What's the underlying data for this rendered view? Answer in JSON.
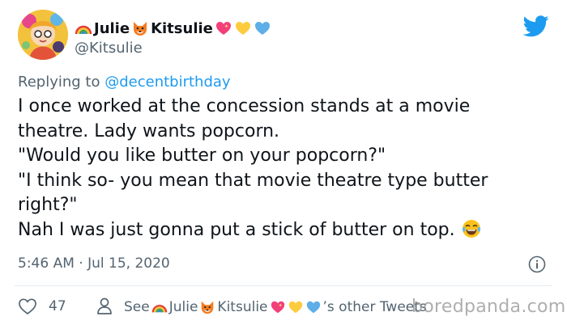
{
  "tweet": {
    "author": {
      "name_part1": "Julie",
      "name_part2": "Kitsulie",
      "handle": "@Kitsulie",
      "emojis": [
        "rainbow-emoji",
        "fox-emoji",
        "sparkling-heart-emoji",
        "yellow-heart-emoji",
        "blue-heart-emoji"
      ]
    },
    "reply": {
      "prefix": "Replying to",
      "mention": "@decentbirthday"
    },
    "text_lines": [
      "I once worked at the concession stands at a movie",
      "theatre. Lady wants popcorn.",
      "\"Would you like butter on your popcorn?\"",
      "\"I think so- you mean that movie theatre type butter",
      "right?\"",
      "Nah I was just gonna put a stick of butter on top."
    ],
    "timestamp": "5:46 AM · Jul 15, 2020",
    "likes": "47",
    "see_tweets": {
      "prefix": "See",
      "name_part1": "Julie",
      "name_part2": "Kitsulie",
      "suffix": "’s other Tweets"
    }
  },
  "watermark": "boredpanda.com",
  "colors": {
    "text": "#0f1419",
    "secondary": "#536471",
    "twitter_blue": "#1d9bf0",
    "divider": "#e6ecf0"
  },
  "icons": [
    "twitter-bird-icon",
    "info-icon",
    "heart-icon",
    "person-icon",
    "face-with-tears-of-joy-emoji"
  ]
}
